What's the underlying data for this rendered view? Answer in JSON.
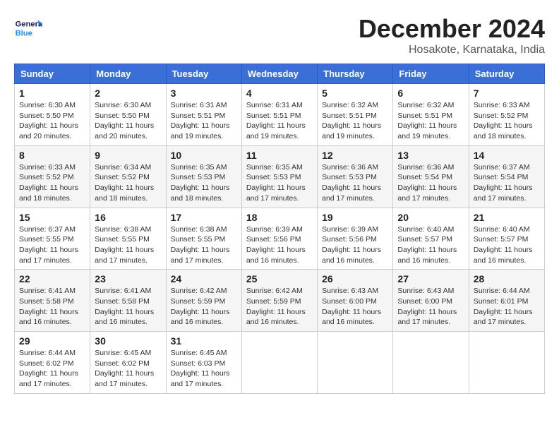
{
  "header": {
    "logo_general": "General",
    "logo_blue": "Blue",
    "month_title": "December 2024",
    "location": "Hosakote, Karnataka, India"
  },
  "days_of_week": [
    "Sunday",
    "Monday",
    "Tuesday",
    "Wednesday",
    "Thursday",
    "Friday",
    "Saturday"
  ],
  "weeks": [
    [
      {
        "day": "1",
        "info": "Sunrise: 6:30 AM\nSunset: 5:50 PM\nDaylight: 11 hours\nand 20 minutes."
      },
      {
        "day": "2",
        "info": "Sunrise: 6:30 AM\nSunset: 5:50 PM\nDaylight: 11 hours\nand 20 minutes."
      },
      {
        "day": "3",
        "info": "Sunrise: 6:31 AM\nSunset: 5:51 PM\nDaylight: 11 hours\nand 19 minutes."
      },
      {
        "day": "4",
        "info": "Sunrise: 6:31 AM\nSunset: 5:51 PM\nDaylight: 11 hours\nand 19 minutes."
      },
      {
        "day": "5",
        "info": "Sunrise: 6:32 AM\nSunset: 5:51 PM\nDaylight: 11 hours\nand 19 minutes."
      },
      {
        "day": "6",
        "info": "Sunrise: 6:32 AM\nSunset: 5:51 PM\nDaylight: 11 hours\nand 19 minutes."
      },
      {
        "day": "7",
        "info": "Sunrise: 6:33 AM\nSunset: 5:52 PM\nDaylight: 11 hours\nand 18 minutes."
      }
    ],
    [
      {
        "day": "8",
        "info": "Sunrise: 6:33 AM\nSunset: 5:52 PM\nDaylight: 11 hours\nand 18 minutes."
      },
      {
        "day": "9",
        "info": "Sunrise: 6:34 AM\nSunset: 5:52 PM\nDaylight: 11 hours\nand 18 minutes."
      },
      {
        "day": "10",
        "info": "Sunrise: 6:35 AM\nSunset: 5:53 PM\nDaylight: 11 hours\nand 18 minutes."
      },
      {
        "day": "11",
        "info": "Sunrise: 6:35 AM\nSunset: 5:53 PM\nDaylight: 11 hours\nand 17 minutes."
      },
      {
        "day": "12",
        "info": "Sunrise: 6:36 AM\nSunset: 5:53 PM\nDaylight: 11 hours\nand 17 minutes."
      },
      {
        "day": "13",
        "info": "Sunrise: 6:36 AM\nSunset: 5:54 PM\nDaylight: 11 hours\nand 17 minutes."
      },
      {
        "day": "14",
        "info": "Sunrise: 6:37 AM\nSunset: 5:54 PM\nDaylight: 11 hours\nand 17 minutes."
      }
    ],
    [
      {
        "day": "15",
        "info": "Sunrise: 6:37 AM\nSunset: 5:55 PM\nDaylight: 11 hours\nand 17 minutes."
      },
      {
        "day": "16",
        "info": "Sunrise: 6:38 AM\nSunset: 5:55 PM\nDaylight: 11 hours\nand 17 minutes."
      },
      {
        "day": "17",
        "info": "Sunrise: 6:38 AM\nSunset: 5:55 PM\nDaylight: 11 hours\nand 17 minutes."
      },
      {
        "day": "18",
        "info": "Sunrise: 6:39 AM\nSunset: 5:56 PM\nDaylight: 11 hours\nand 16 minutes."
      },
      {
        "day": "19",
        "info": "Sunrise: 6:39 AM\nSunset: 5:56 PM\nDaylight: 11 hours\nand 16 minutes."
      },
      {
        "day": "20",
        "info": "Sunrise: 6:40 AM\nSunset: 5:57 PM\nDaylight: 11 hours\nand 16 minutes."
      },
      {
        "day": "21",
        "info": "Sunrise: 6:40 AM\nSunset: 5:57 PM\nDaylight: 11 hours\nand 16 minutes."
      }
    ],
    [
      {
        "day": "22",
        "info": "Sunrise: 6:41 AM\nSunset: 5:58 PM\nDaylight: 11 hours\nand 16 minutes."
      },
      {
        "day": "23",
        "info": "Sunrise: 6:41 AM\nSunset: 5:58 PM\nDaylight: 11 hours\nand 16 minutes."
      },
      {
        "day": "24",
        "info": "Sunrise: 6:42 AM\nSunset: 5:59 PM\nDaylight: 11 hours\nand 16 minutes."
      },
      {
        "day": "25",
        "info": "Sunrise: 6:42 AM\nSunset: 5:59 PM\nDaylight: 11 hours\nand 16 minutes."
      },
      {
        "day": "26",
        "info": "Sunrise: 6:43 AM\nSunset: 6:00 PM\nDaylight: 11 hours\nand 16 minutes."
      },
      {
        "day": "27",
        "info": "Sunrise: 6:43 AM\nSunset: 6:00 PM\nDaylight: 11 hours\nand 17 minutes."
      },
      {
        "day": "28",
        "info": "Sunrise: 6:44 AM\nSunset: 6:01 PM\nDaylight: 11 hours\nand 17 minutes."
      }
    ],
    [
      {
        "day": "29",
        "info": "Sunrise: 6:44 AM\nSunset: 6:02 PM\nDaylight: 11 hours\nand 17 minutes."
      },
      {
        "day": "30",
        "info": "Sunrise: 6:45 AM\nSunset: 6:02 PM\nDaylight: 11 hours\nand 17 minutes."
      },
      {
        "day": "31",
        "info": "Sunrise: 6:45 AM\nSunset: 6:03 PM\nDaylight: 11 hours\nand 17 minutes."
      },
      null,
      null,
      null,
      null
    ]
  ]
}
